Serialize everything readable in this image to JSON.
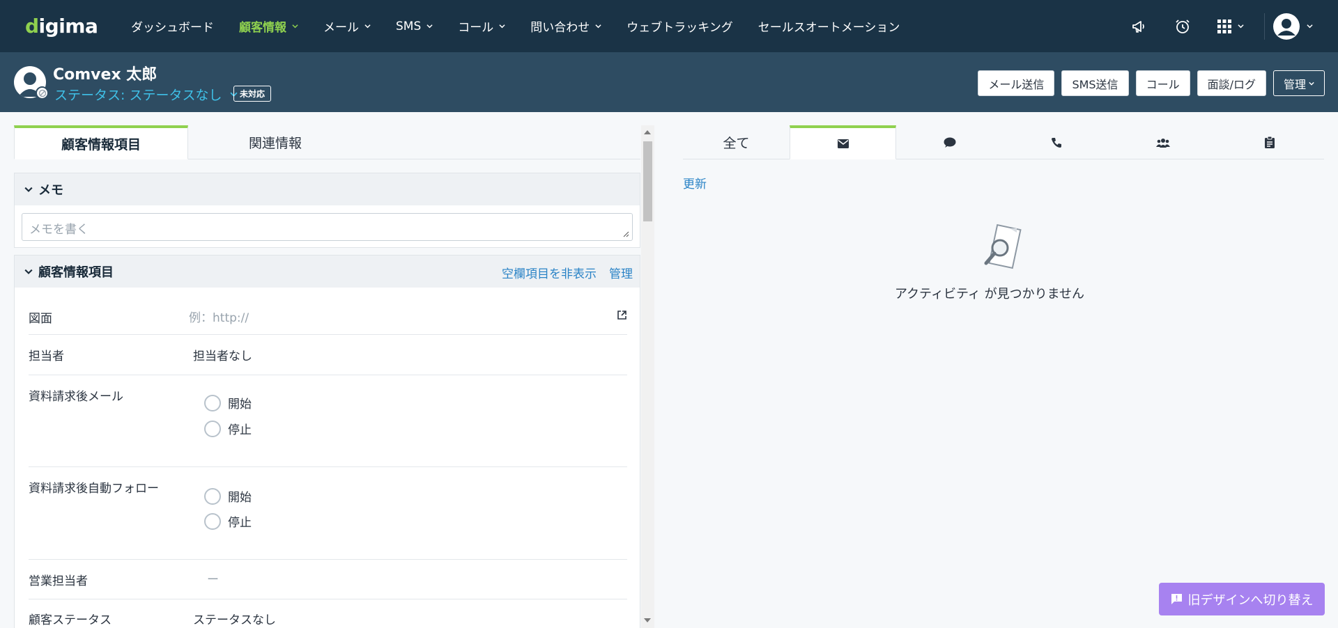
{
  "nav": {
    "logo_text": "igima",
    "logo_prefix": "d",
    "items": [
      {
        "label": "ダッシュボード"
      },
      {
        "label": "顧客情報"
      },
      {
        "label": "メール"
      },
      {
        "label": "SMS"
      },
      {
        "label": "コール"
      },
      {
        "label": "問い合わせ"
      },
      {
        "label": "ウェブトラッキング"
      },
      {
        "label": "セールスオートメーション"
      }
    ],
    "icons": [
      "megaphone-icon",
      "alarm-clock-icon",
      "apps-grid-icon",
      "user-avatar-icon"
    ]
  },
  "customer": {
    "name": "Comvex 太郎",
    "status": "ステータス: ステータスなし",
    "badge": "未対応"
  },
  "header_actions": {
    "send_email": "メール送信",
    "send_sms": "SMS送信",
    "call": "コール",
    "meeting_log": "面談/ログ",
    "manage": "管理"
  },
  "left_tabs": {
    "customer_fields": "顧客情報項目",
    "related_info": "関連情報"
  },
  "memo": {
    "title": "メモ",
    "placeholder": "メモを書く"
  },
  "info": {
    "title": "顧客情報項目",
    "hide_empty": "空欄項目を非表示",
    "manage": "管理",
    "fields": {
      "drawing_label": "図面",
      "drawing_placeholder": "例：http://",
      "assignee_label": "担当者",
      "assignee_value": "担当者なし",
      "mail_after_request_label": "資料請求後メール",
      "auto_follow_label": "資料請求後自動フォロー",
      "option_start": "開始",
      "option_stop": "停止",
      "sales_rep_label": "営業担当者",
      "sales_rep_value": "ー",
      "customer_status_label": "顧客ステータス",
      "customer_status_value": "ステータスなし"
    }
  },
  "right_tabs": {
    "all": "全て"
  },
  "activity": {
    "refresh": "更新",
    "empty": "アクティビティ が見つかりません"
  },
  "switch_button": "旧デザインへ切り替え",
  "colors": {
    "navbar": "#1a3346",
    "header": "#2e4c62",
    "accent_green": "#8fd14f",
    "link_blue": "#2a83c6",
    "status_cyan": "#3fc1e8",
    "switch_purple": "#a782f0"
  }
}
